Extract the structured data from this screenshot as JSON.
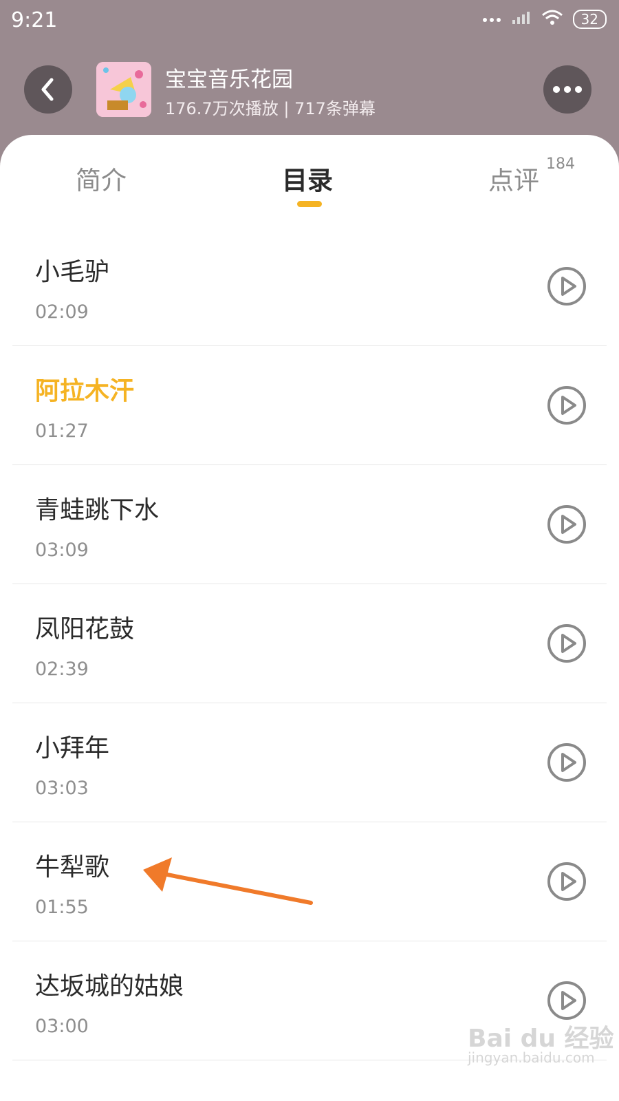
{
  "status": {
    "time": "9:21",
    "battery": "32"
  },
  "album": {
    "title": "宝宝音乐花园",
    "meta": "176.7万次播放 | 717条弹幕"
  },
  "tabs": {
    "intro": "简介",
    "catalog": "目录",
    "review": "点评",
    "review_count": "184"
  },
  "tracks": [
    {
      "title": "小毛驴",
      "duration": "02:09"
    },
    {
      "title": "阿拉木汗",
      "duration": "01:27"
    },
    {
      "title": "青蛙跳下水",
      "duration": "03:09"
    },
    {
      "title": "凤阳花鼓",
      "duration": "02:39"
    },
    {
      "title": "小拜年",
      "duration": "03:03"
    },
    {
      "title": "牛犁歌",
      "duration": "01:55"
    },
    {
      "title": "达坂城的姑娘",
      "duration": "03:00"
    }
  ],
  "colors": {
    "accent": "#f5b323",
    "annotation_arrow": "#f07a2a",
    "header_bg": "#9a8a8f"
  },
  "watermark": {
    "brand": "Bai du 经验",
    "url": "jingyan.baidu.com"
  }
}
